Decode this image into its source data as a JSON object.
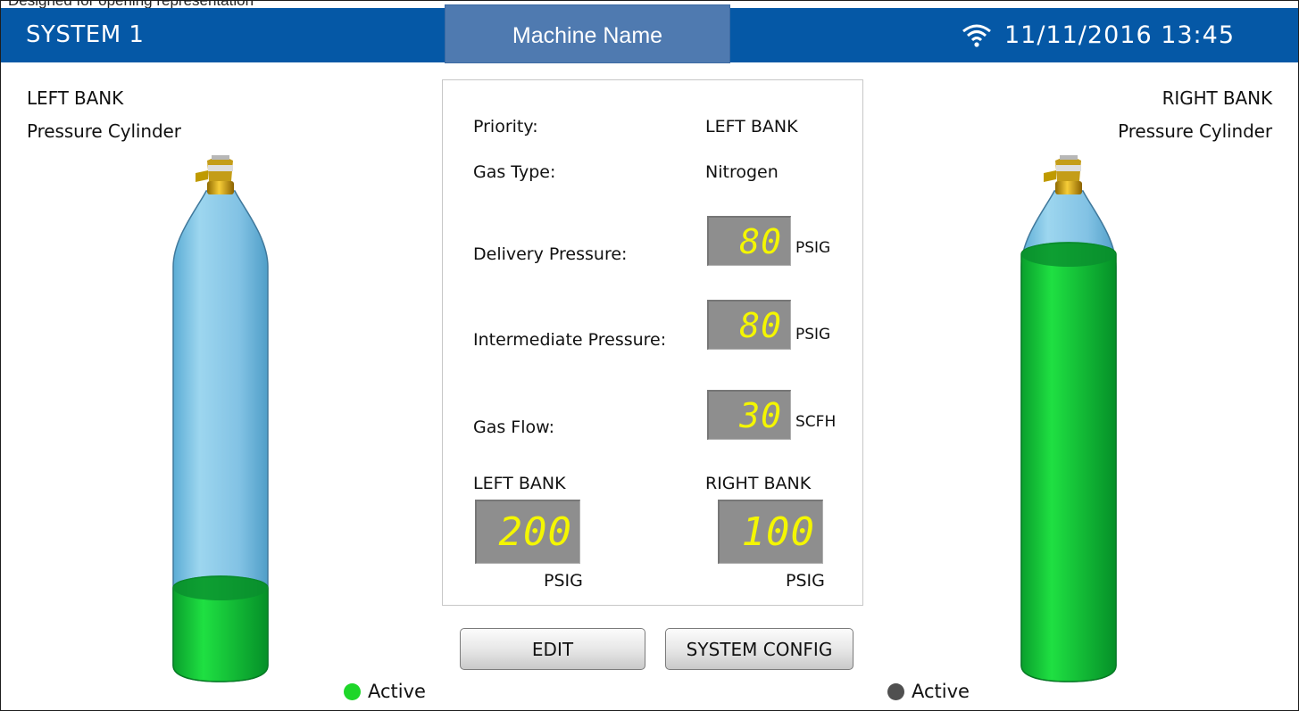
{
  "top_fragment": "Designed for opening representation",
  "header": {
    "system": "SYSTEM 1",
    "machine": "Machine Name",
    "wifi_icon": "wifi-icon",
    "datetime": "11/11/2016  13:45"
  },
  "left": {
    "title": "LEFT BANK",
    "subtitle": "Pressure Cylinder",
    "fill_fraction": 0.17,
    "status": "Active",
    "status_color": "#1ed629"
  },
  "right": {
    "title": "RIGHT BANK",
    "subtitle": "Pressure Cylinder",
    "fill_fraction": 0.78,
    "status": "Active",
    "status_color": "#505050"
  },
  "center": {
    "priority_label": "Priority:",
    "priority_value": "LEFT BANK",
    "gas_type_label": "Gas Type:",
    "gas_type_value": "Nitrogen",
    "delivery_label": "Delivery Pressure:",
    "delivery_value": "80",
    "delivery_unit": "PSIG",
    "intermediate_label": "Intermediate Pressure:",
    "intermediate_value": "80",
    "intermediate_unit": "PSIG",
    "flow_label": "Gas Flow:",
    "flow_value": "30",
    "flow_unit": "SCFH",
    "left_bank_label": "LEFT BANK",
    "left_bank_value": "200",
    "left_bank_unit": "PSIG",
    "right_bank_label": "RIGHT BANK",
    "right_bank_value": "100",
    "right_bank_unit": "PSIG"
  },
  "buttons": {
    "edit": "EDIT",
    "system_config": "SYSTEM CONFIG"
  },
  "colors": {
    "header": "#0558a6",
    "machine_box": "#4f7ab0",
    "cylinder_blue": "#86c5e3",
    "gas_green": "#12bf35",
    "digit_yellow": "#f4f600"
  }
}
